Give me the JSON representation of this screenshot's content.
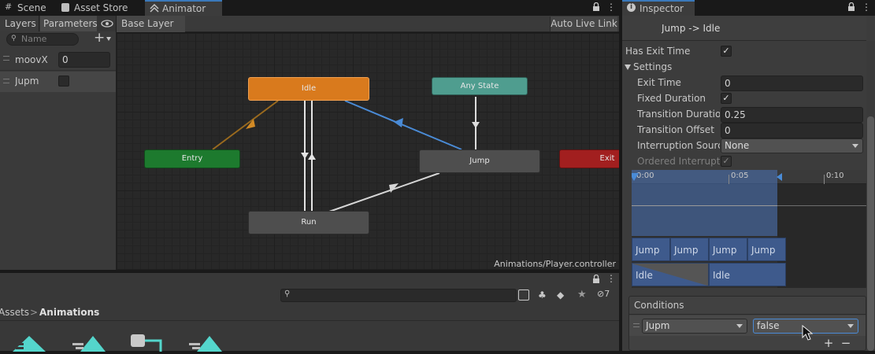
{
  "tabs": {
    "scene": "Scene",
    "asset_store": "Asset Store",
    "animator": "Animator",
    "inspector": "Inspector"
  },
  "animator": {
    "layers_tab": "Layers",
    "parameters_tab": "Parameters",
    "search_placeholder": "Name",
    "breadcrumb": "Base Layer",
    "auto_live_link": "Auto Live Link",
    "controller_path": "Animations/Player.controller",
    "params": [
      {
        "name": "moovX",
        "value": "0"
      },
      {
        "name": "Jupm",
        "value": ""
      }
    ],
    "nodes": {
      "idle": "Idle",
      "any_state": "Any State",
      "entry": "Entry",
      "jump": "Jump",
      "exit": "Exit",
      "run": "Run"
    },
    "colors": {
      "idle": "#d97a1d",
      "any_state": "#4f9d8f",
      "entry": "#1d7a2e",
      "exit": "#a21f1f",
      "state": "#4e4e4e",
      "selected_transition": "#4a8bd6"
    }
  },
  "project": {
    "breadcrumb_root": "Assets",
    "breadcrumb_current": "Animations",
    "count": "7"
  },
  "inspector": {
    "title": "Jump -> Idle",
    "has_exit_time_label": "Has Exit Time",
    "settings_label": "Settings",
    "exit_time_label": "Exit Time",
    "exit_time_value": "0",
    "fixed_duration_label": "Fixed Duration",
    "transition_duration_label": "Transition Duration",
    "transition_duration_value": "0.25",
    "transition_offset_label": "Transition Offset",
    "transition_offset_value": "0",
    "interruption_source_label": "Interruption Source",
    "interruption_source_value": "None",
    "ordered_interruption_label": "Ordered Interruption",
    "timeline_ticks": [
      "0:00",
      "0:05",
      "0:10"
    ],
    "clips_top": [
      "Jump",
      "Jump",
      "Jump",
      "Jump"
    ],
    "clips_bottom": [
      "Idle",
      "Idle"
    ],
    "conditions_label": "Conditions",
    "condition_param": "Jupm",
    "condition_value": "false"
  }
}
